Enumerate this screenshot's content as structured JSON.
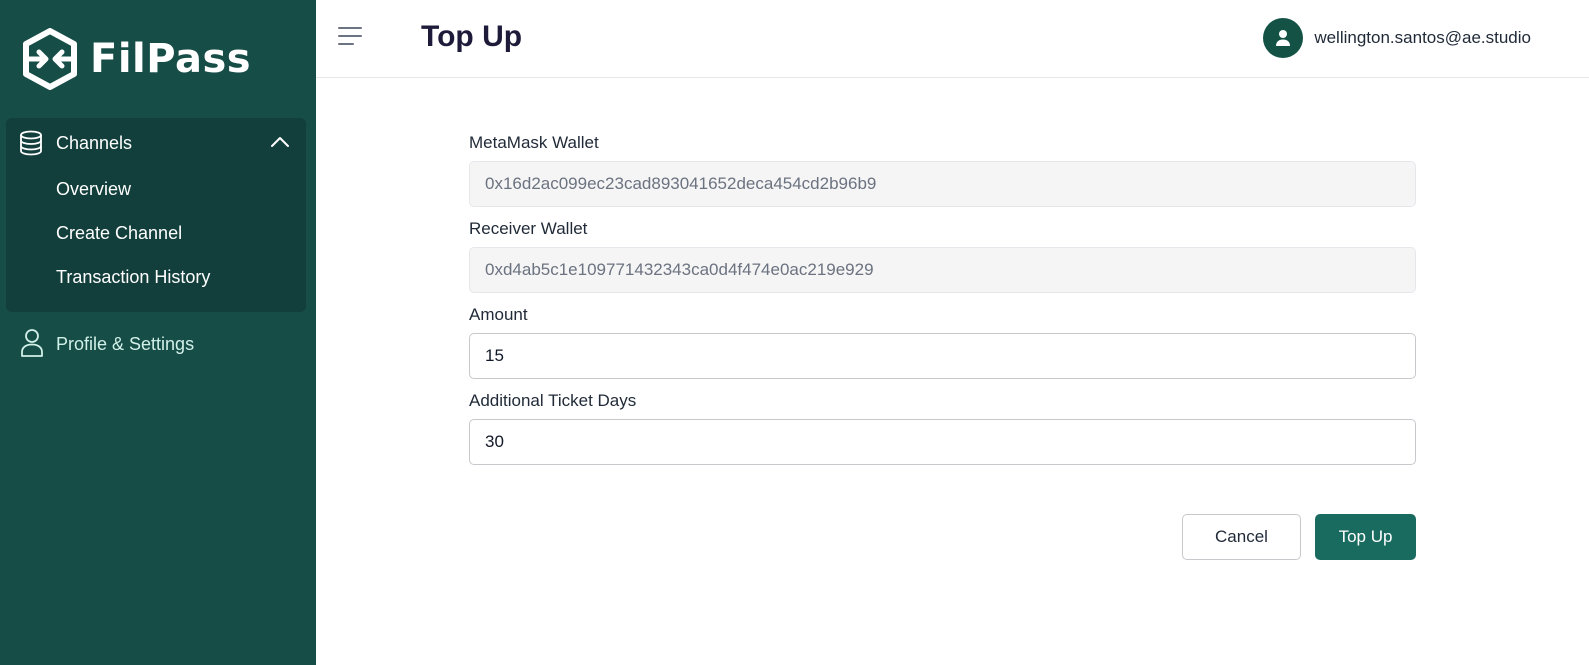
{
  "brand": {
    "name": "FilPass"
  },
  "sidebar": {
    "channels_label": "Channels",
    "sub_items": [
      {
        "label": "Overview"
      },
      {
        "label": "Create Channel"
      },
      {
        "label": "Transaction History"
      }
    ],
    "profile_label": "Profile & Settings"
  },
  "header": {
    "title": "Top Up",
    "user_email": "wellington.santos@ae.studio"
  },
  "form": {
    "metamask": {
      "label": "MetaMask Wallet",
      "value": "0x16d2ac099ec23cad893041652deca454cd2b96b9"
    },
    "receiver": {
      "label": "Receiver Wallet",
      "value": "0xd4ab5c1e109771432343ca0d4f474e0ac219e929"
    },
    "amount": {
      "label": "Amount",
      "value": "15"
    },
    "ticket_days": {
      "label": "Additional Ticket Days",
      "value": "30"
    }
  },
  "actions": {
    "cancel_label": "Cancel",
    "submit_label": "Top Up"
  },
  "colors": {
    "sidebar_bg": "#164d47",
    "sidebar_group_bg": "#123f3b",
    "primary": "#196b5f",
    "avatar_bg": "#135245",
    "title_color": "#1e1b3a"
  },
  "icons": {
    "logo": "filpass-logo-icon",
    "channels": "database-icon",
    "collapse": "chevron-up-icon",
    "profile": "user-icon",
    "menu": "hamburger-menu-icon",
    "avatar": "user-avatar-icon"
  }
}
